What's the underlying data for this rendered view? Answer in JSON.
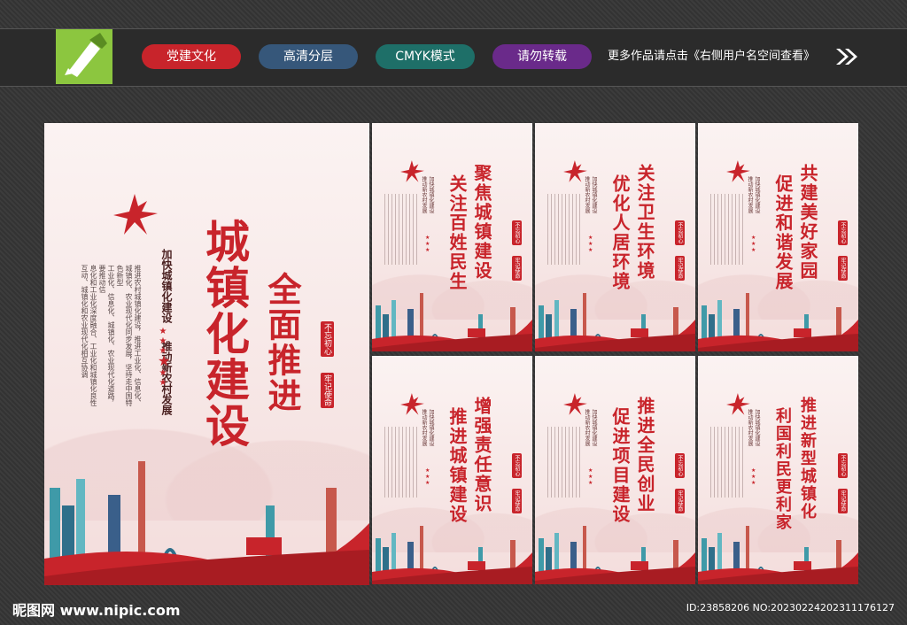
{
  "toolbar": {
    "tags": [
      {
        "label": "党建文化",
        "color": "#c8242b"
      },
      {
        "label": "高清分层",
        "color": "#36577a"
      },
      {
        "label": "CMYK模式",
        "color": "#1e6f68"
      },
      {
        "label": "请勿转载",
        "color": "#6a2a8a"
      }
    ],
    "notice": "更多作品请点击《右侧用户名空间查看》",
    "logo_icon": "pen-nib-icon",
    "arrow_icon": "double-chevron-right-icon"
  },
  "main_poster": {
    "title_large": "城镇化建设",
    "title_second": "全面推进",
    "subtitle_1": "加快城镇化建设",
    "subtitle_2": "推动新农村发展",
    "seal_1": "不忘初心",
    "seal_2": "牢记使命",
    "body_lines": [
      "推进农村城镇化建设，推进工业化、信息化、",
      "城镇化、农业现代化同步发展，坚持走中国特色新型",
      "工业化、信息化、城镇化、农业现代化道路，要推动信",
      "息化和工业化深度融合、工业化和城镇化良性",
      "互动、城镇化和农业现代化相互协调"
    ]
  },
  "panels": [
    {
      "line1": "聚焦城镇建设",
      "line2": "关注百姓民生"
    },
    {
      "line1": "关注卫生环境",
      "line2": "优化人居环境"
    },
    {
      "line1": "共建美好家园",
      "line2": "促进和谐发展"
    },
    {
      "line1": "增强责任意识",
      "line2": "推进城镇建设"
    },
    {
      "line1": "推进全民创业",
      "line2": "促进项目建设"
    },
    {
      "line1": "推进新型城镇化",
      "line2": "利国利民更利家"
    }
  ],
  "panel_common": {
    "sub_1": "加快城镇化建设",
    "sub_2": "推动新农村发展",
    "seal_1": "不忘初心",
    "seal_2": "牢记使命"
  },
  "footer": {
    "site": "昵图网 www.nipic.com",
    "id": "ID:23858206 NO:20230224202311176127"
  },
  "colors": {
    "accent": "#c8242b",
    "logo_green": "#8cc63f"
  }
}
